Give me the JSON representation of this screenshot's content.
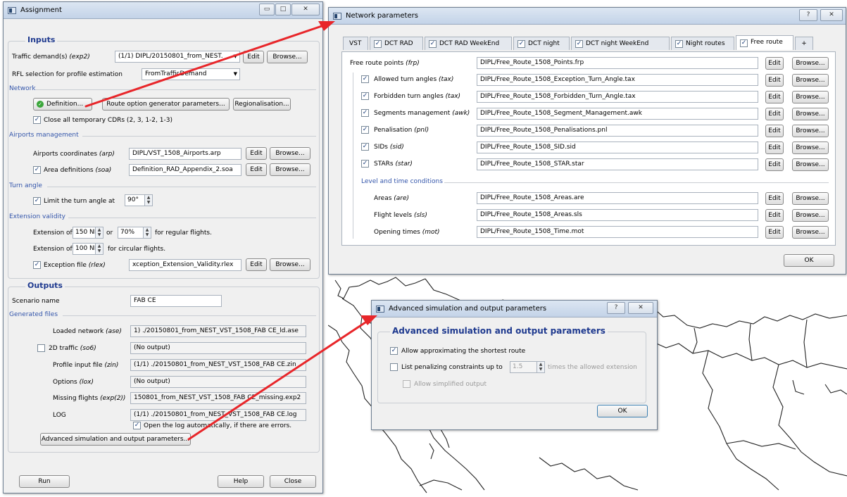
{
  "assignment": {
    "title": "Assignment",
    "inputs": {
      "group_title": "Inputs",
      "traffic_label": "Traffic demand(s) ",
      "traffic_code": "(exp2)",
      "traffic_value": "(1/1) DIPL/20150801_from_NEST.",
      "edit": "Edit",
      "browse": "Browse...",
      "rfl_label": "RFL selection for profile estimation",
      "rfl_value": "FromTrafficDemand",
      "network_section": "Network",
      "definition_btn": "Definition...",
      "route_option_btn": "Route option generator parameters...",
      "regionalisation_btn": "Regionalisation...",
      "close_cdrs_label": "Close all temporary CDRs (2, 3, 1-2, 1-3)",
      "airports_section": "Airports management",
      "airports_coord_label": "Airports coordinates ",
      "airports_coord_code": "(arp)",
      "airports_coord_value": "DIPL/VST_1508_Airports.arp",
      "area_def_label": "Area definitions ",
      "area_def_code": "(soa)",
      "area_def_value": "Definition_RAD_Appendix_2.soa",
      "turn_section": "Turn angle",
      "limit_turn_label": "Limit the turn angle at",
      "turn_value": "90°",
      "extension_section": "Extension validity",
      "ext_of": "Extension of",
      "ext_nm_1": "150 NM",
      "or": "or",
      "ext_pct": "70%",
      "regular_flights": "for regular flights.",
      "ext_nm_2": "100 NM",
      "circular_flights": "for circular flights.",
      "exception_label": "Exception file ",
      "exception_code": "(rlex)",
      "exception_value": "xception_Extension_Validity.rlex"
    },
    "outputs": {
      "group_title": "Outputs",
      "scenario_label": "Scenario name",
      "scenario_value": "FAB CE",
      "generated_section": "Generated files",
      "loaded_label": "Loaded network ",
      "loaded_code": "(ase)",
      "loaded_value": "1) ./20150801_from_NEST_VST_1508_FAB CE_ld.ase",
      "traffic2d_label": "2D traffic ",
      "traffic2d_code": "(so6)",
      "traffic2d_value": "(No output)",
      "profile_label": "Profile input file ",
      "profile_code": "(zin)",
      "profile_value": "(1/1) ./20150801_from_NEST_VST_1508_FAB CE.zin",
      "options_label": "Options ",
      "options_code": "(lox)",
      "options_value": "(No output)",
      "missing_label": "Missing flights ",
      "missing_code": "(exp(2))",
      "missing_value": "150801_from_NEST_VST_1508_FAB CE_missing.exp2",
      "log_label": "LOG",
      "log_value": "(1/1) ./20150801_from_NEST_VST_1508_FAB CE.log",
      "open_log_label": "Open the log automatically, if there are errors.",
      "advanced_btn": "Advanced simulation and output parameters..."
    },
    "run": "Run",
    "help": "Help",
    "close": "Close"
  },
  "network": {
    "title": "Network parameters",
    "help_btn": "?",
    "tabs": [
      {
        "label": "VST",
        "checked": false
      },
      {
        "label": "DCT RAD",
        "checked": true
      },
      {
        "label": "DCT RAD WeekEnd",
        "checked": true
      },
      {
        "label": "DCT night",
        "checked": true
      },
      {
        "label": "DCT night WeekEnd",
        "checked": true
      },
      {
        "label": "Night routes",
        "checked": true
      },
      {
        "label": "Free route",
        "checked": true
      },
      {
        "label": "+",
        "checked": false
      }
    ],
    "points_label": "Free route points ",
    "points_code": "(frp)",
    "points_value": "DIPL/Free_Route_1508_Points.frp",
    "rows": [
      {
        "label": "Allowed turn angles ",
        "code": "(tax)",
        "value": "DIPL/Free_Route_1508_Exception_Turn_Angle.tax"
      },
      {
        "label": "Forbidden turn angles ",
        "code": "(tax)",
        "value": "DIPL/Free_Route_1508_Forbidden_Turn_Angle.tax"
      },
      {
        "label": "Segments management ",
        "code": "(awk)",
        "value": "DIPL/Free_Route_1508_Segment_Management.awk"
      },
      {
        "label": "Penalisation ",
        "code": "(pnl)",
        "value": "DIPL/Free_Route_1508_Penalisations.pnl"
      },
      {
        "label": "SIDs ",
        "code": "(sid)",
        "value": "DIPL/Free_Route_1508_SID.sid"
      },
      {
        "label": "STARs ",
        "code": "(star)",
        "value": "DIPL/Free_Route_1508_STAR.star"
      }
    ],
    "level_section": "Level and time conditions",
    "level_rows": [
      {
        "label": "Areas ",
        "code": "(are)",
        "value": "DIPL/Free_Route_1508_Areas.are"
      },
      {
        "label": "Flight levels ",
        "code": "(sls)",
        "value": "DIPL/Free_Route_1508_Areas.sls"
      },
      {
        "label": "Opening times ",
        "code": "(mot)",
        "value": "DIPL/Free_Route_1508_Time.mot"
      }
    ],
    "edit": "Edit",
    "browse": "Browse...",
    "ok": "OK"
  },
  "advanced": {
    "title": "Advanced simulation and output parameters",
    "group_title": "Advanced simulation and output parameters",
    "allow_approx": "Allow approximating the shortest route",
    "list_penalizing": "List penalizing constraints up to",
    "times_value": "1.5",
    "times_allowed": "times the allowed extension",
    "allow_simplified": "Allow simplified output",
    "ok": "OK",
    "help_btn": "?"
  },
  "colors": {
    "arrow": "#e8262a",
    "title_blue": "#1f3a8f",
    "section_blue": "#3355aa",
    "map_line": "#222222"
  },
  "icons": [
    "window-icon",
    "check-circle-icon",
    "checkbox-icon",
    "spin-arrows-icon",
    "red-arrow-icon"
  ]
}
